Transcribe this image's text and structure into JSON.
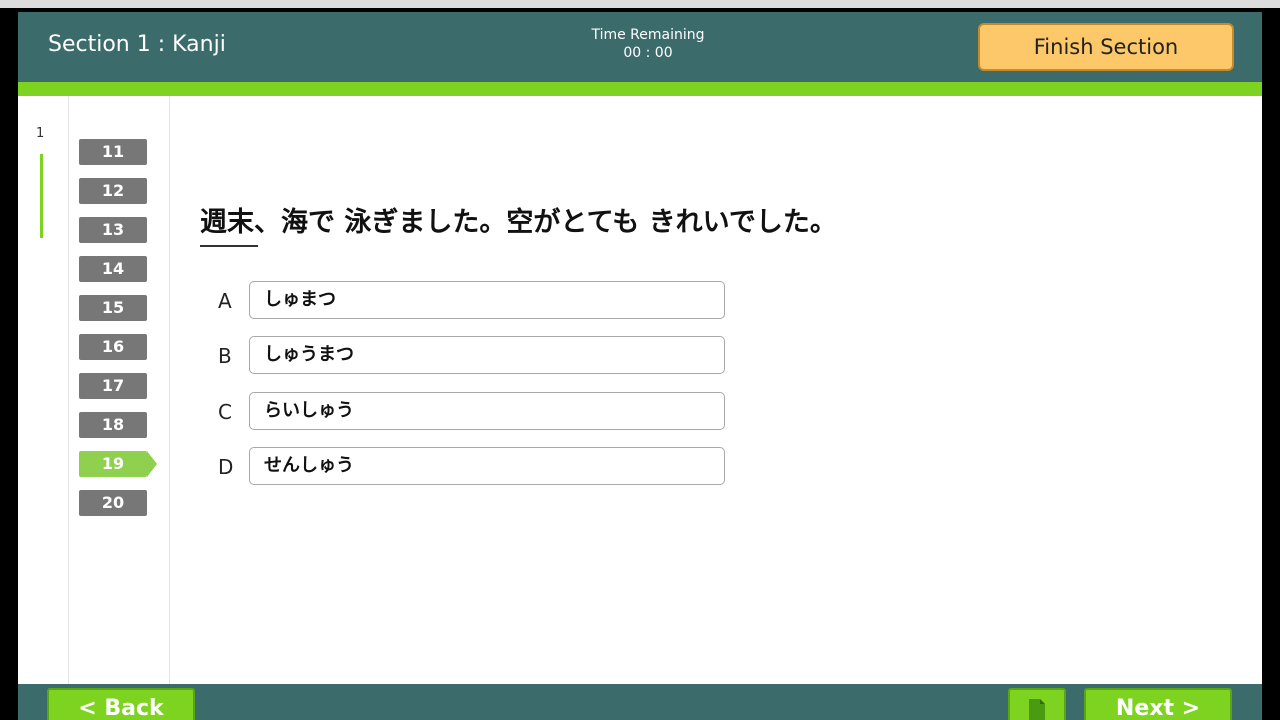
{
  "header": {
    "section_title": "Section 1 : Kanji",
    "timer_label": "Time Remaining",
    "timer_value": "00 : 00",
    "finish_label": "Finish Section"
  },
  "nav": {
    "page_number": "1"
  },
  "questions": {
    "items": [
      "11",
      "12",
      "13",
      "14",
      "15",
      "16",
      "17",
      "18",
      "19",
      "20"
    ],
    "active": "19"
  },
  "question": {
    "text": "週末、海で 泳ぎました。空がとても きれいでした。",
    "options": [
      {
        "letter": "A",
        "text": "しゅまつ"
      },
      {
        "letter": "B",
        "text": "しゅうまつ"
      },
      {
        "letter": "C",
        "text": "らいしゅう"
      },
      {
        "letter": "D",
        "text": "せんしゅう"
      }
    ]
  },
  "footer": {
    "back_label": "< Back",
    "next_label": "Next >",
    "notes_icon": "document-icon"
  },
  "colors": {
    "header_bg": "#3c6b6b",
    "accent_green": "#7ed321",
    "finish_orange": "#fcc869",
    "question_gray": "#777777"
  }
}
